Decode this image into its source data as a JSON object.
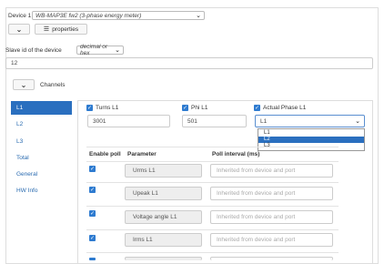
{
  "device": {
    "label": "Device 1",
    "selected": "WB-MAP3E fw2 (3-phase energy meter)",
    "properties_label": "properties"
  },
  "slave": {
    "label": "Slave id of the device",
    "mode": "decimal or hex",
    "value": "12"
  },
  "channels": {
    "label": "Channels"
  },
  "nav": {
    "items": [
      {
        "label": "L1"
      },
      {
        "label": "L2"
      },
      {
        "label": "L3"
      },
      {
        "label": "Total"
      },
      {
        "label": "General"
      },
      {
        "label": "HW Info"
      }
    ]
  },
  "fields": {
    "turns": {
      "label": "Turns L1",
      "value": "3001"
    },
    "phi": {
      "label": "Phi L1",
      "value": "501"
    },
    "phase": {
      "label": "Actual Phase L1",
      "value": "L1",
      "options": [
        "L1",
        "L2",
        "L3"
      ]
    }
  },
  "table": {
    "headers": [
      "Enable poll",
      "Parameter",
      "Poll interval (ms)"
    ],
    "placeholder": "Inherited from device and port",
    "rows": [
      {
        "parameter": "Urms L1"
      },
      {
        "parameter": "Upeak L1"
      },
      {
        "parameter": "Voltage angle L1"
      },
      {
        "parameter": "Irms L1"
      }
    ]
  }
}
